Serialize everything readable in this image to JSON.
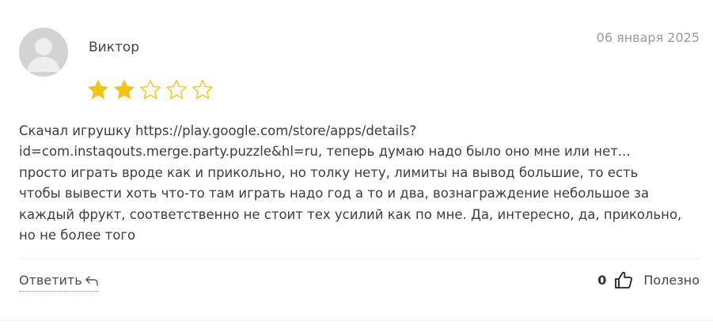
{
  "review": {
    "author": "Виктор",
    "date": "06 января 2025",
    "rating": 2,
    "rating_max": 5,
    "star_color": "#f0c419",
    "text_lines": [
      "Скачал игрушку https://play.google.com/store/apps/details?",
      "id=com.instaqouts.merge.party.puzzle&hl=ru, теперь думаю надо было оно мне или нет...",
      "просто играть вроде как и прикольно, но толку нету, лимиты на вывод большие, то есть",
      "чтобы вывести хоть что-то там играть надо год а то и два, вознаграждение небольшое за",
      "каждый фрукт, соответственно не стоит тех усилий как по мне. Да, интересно, да, прикольно,",
      "но не более того"
    ]
  },
  "actions": {
    "reply_label": "Ответить",
    "reply_icon": "reply-arrow-icon",
    "useful_count": "0",
    "useful_label": "Полезно",
    "like_icon": "thumbs-up-icon"
  }
}
